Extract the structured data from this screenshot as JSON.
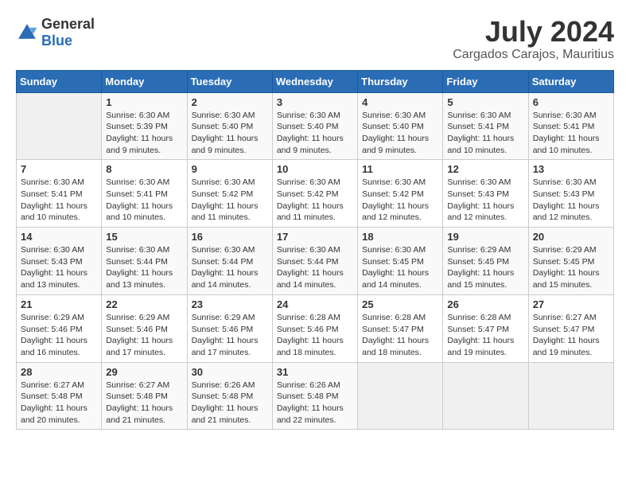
{
  "logo": {
    "general": "General",
    "blue": "Blue"
  },
  "title": "July 2024",
  "location": "Cargados Carajos, Mauritius",
  "days_of_week": [
    "Sunday",
    "Monday",
    "Tuesday",
    "Wednesday",
    "Thursday",
    "Friday",
    "Saturday"
  ],
  "weeks": [
    [
      {
        "num": "",
        "sunrise": "",
        "sunset": "",
        "daylight": ""
      },
      {
        "num": "1",
        "sunrise": "Sunrise: 6:30 AM",
        "sunset": "Sunset: 5:39 PM",
        "daylight": "Daylight: 11 hours and 9 minutes."
      },
      {
        "num": "2",
        "sunrise": "Sunrise: 6:30 AM",
        "sunset": "Sunset: 5:40 PM",
        "daylight": "Daylight: 11 hours and 9 minutes."
      },
      {
        "num": "3",
        "sunrise": "Sunrise: 6:30 AM",
        "sunset": "Sunset: 5:40 PM",
        "daylight": "Daylight: 11 hours and 9 minutes."
      },
      {
        "num": "4",
        "sunrise": "Sunrise: 6:30 AM",
        "sunset": "Sunset: 5:40 PM",
        "daylight": "Daylight: 11 hours and 9 minutes."
      },
      {
        "num": "5",
        "sunrise": "Sunrise: 6:30 AM",
        "sunset": "Sunset: 5:41 PM",
        "daylight": "Daylight: 11 hours and 10 minutes."
      },
      {
        "num": "6",
        "sunrise": "Sunrise: 6:30 AM",
        "sunset": "Sunset: 5:41 PM",
        "daylight": "Daylight: 11 hours and 10 minutes."
      }
    ],
    [
      {
        "num": "7",
        "sunrise": "Sunrise: 6:30 AM",
        "sunset": "Sunset: 5:41 PM",
        "daylight": "Daylight: 11 hours and 10 minutes."
      },
      {
        "num": "8",
        "sunrise": "Sunrise: 6:30 AM",
        "sunset": "Sunset: 5:41 PM",
        "daylight": "Daylight: 11 hours and 10 minutes."
      },
      {
        "num": "9",
        "sunrise": "Sunrise: 6:30 AM",
        "sunset": "Sunset: 5:42 PM",
        "daylight": "Daylight: 11 hours and 11 minutes."
      },
      {
        "num": "10",
        "sunrise": "Sunrise: 6:30 AM",
        "sunset": "Sunset: 5:42 PM",
        "daylight": "Daylight: 11 hours and 11 minutes."
      },
      {
        "num": "11",
        "sunrise": "Sunrise: 6:30 AM",
        "sunset": "Sunset: 5:42 PM",
        "daylight": "Daylight: 11 hours and 12 minutes."
      },
      {
        "num": "12",
        "sunrise": "Sunrise: 6:30 AM",
        "sunset": "Sunset: 5:43 PM",
        "daylight": "Daylight: 11 hours and 12 minutes."
      },
      {
        "num": "13",
        "sunrise": "Sunrise: 6:30 AM",
        "sunset": "Sunset: 5:43 PM",
        "daylight": "Daylight: 11 hours and 12 minutes."
      }
    ],
    [
      {
        "num": "14",
        "sunrise": "Sunrise: 6:30 AM",
        "sunset": "Sunset: 5:43 PM",
        "daylight": "Daylight: 11 hours and 13 minutes."
      },
      {
        "num": "15",
        "sunrise": "Sunrise: 6:30 AM",
        "sunset": "Sunset: 5:44 PM",
        "daylight": "Daylight: 11 hours and 13 minutes."
      },
      {
        "num": "16",
        "sunrise": "Sunrise: 6:30 AM",
        "sunset": "Sunset: 5:44 PM",
        "daylight": "Daylight: 11 hours and 14 minutes."
      },
      {
        "num": "17",
        "sunrise": "Sunrise: 6:30 AM",
        "sunset": "Sunset: 5:44 PM",
        "daylight": "Daylight: 11 hours and 14 minutes."
      },
      {
        "num": "18",
        "sunrise": "Sunrise: 6:30 AM",
        "sunset": "Sunset: 5:45 PM",
        "daylight": "Daylight: 11 hours and 14 minutes."
      },
      {
        "num": "19",
        "sunrise": "Sunrise: 6:29 AM",
        "sunset": "Sunset: 5:45 PM",
        "daylight": "Daylight: 11 hours and 15 minutes."
      },
      {
        "num": "20",
        "sunrise": "Sunrise: 6:29 AM",
        "sunset": "Sunset: 5:45 PM",
        "daylight": "Daylight: 11 hours and 15 minutes."
      }
    ],
    [
      {
        "num": "21",
        "sunrise": "Sunrise: 6:29 AM",
        "sunset": "Sunset: 5:46 PM",
        "daylight": "Daylight: 11 hours and 16 minutes."
      },
      {
        "num": "22",
        "sunrise": "Sunrise: 6:29 AM",
        "sunset": "Sunset: 5:46 PM",
        "daylight": "Daylight: 11 hours and 17 minutes."
      },
      {
        "num": "23",
        "sunrise": "Sunrise: 6:29 AM",
        "sunset": "Sunset: 5:46 PM",
        "daylight": "Daylight: 11 hours and 17 minutes."
      },
      {
        "num": "24",
        "sunrise": "Sunrise: 6:28 AM",
        "sunset": "Sunset: 5:46 PM",
        "daylight": "Daylight: 11 hours and 18 minutes."
      },
      {
        "num": "25",
        "sunrise": "Sunrise: 6:28 AM",
        "sunset": "Sunset: 5:47 PM",
        "daylight": "Daylight: 11 hours and 18 minutes."
      },
      {
        "num": "26",
        "sunrise": "Sunrise: 6:28 AM",
        "sunset": "Sunset: 5:47 PM",
        "daylight": "Daylight: 11 hours and 19 minutes."
      },
      {
        "num": "27",
        "sunrise": "Sunrise: 6:27 AM",
        "sunset": "Sunset: 5:47 PM",
        "daylight": "Daylight: 11 hours and 19 minutes."
      }
    ],
    [
      {
        "num": "28",
        "sunrise": "Sunrise: 6:27 AM",
        "sunset": "Sunset: 5:48 PM",
        "daylight": "Daylight: 11 hours and 20 minutes."
      },
      {
        "num": "29",
        "sunrise": "Sunrise: 6:27 AM",
        "sunset": "Sunset: 5:48 PM",
        "daylight": "Daylight: 11 hours and 21 minutes."
      },
      {
        "num": "30",
        "sunrise": "Sunrise: 6:26 AM",
        "sunset": "Sunset: 5:48 PM",
        "daylight": "Daylight: 11 hours and 21 minutes."
      },
      {
        "num": "31",
        "sunrise": "Sunrise: 6:26 AM",
        "sunset": "Sunset: 5:48 PM",
        "daylight": "Daylight: 11 hours and 22 minutes."
      },
      {
        "num": "",
        "sunrise": "",
        "sunset": "",
        "daylight": ""
      },
      {
        "num": "",
        "sunrise": "",
        "sunset": "",
        "daylight": ""
      },
      {
        "num": "",
        "sunrise": "",
        "sunset": "",
        "daylight": ""
      }
    ]
  ]
}
